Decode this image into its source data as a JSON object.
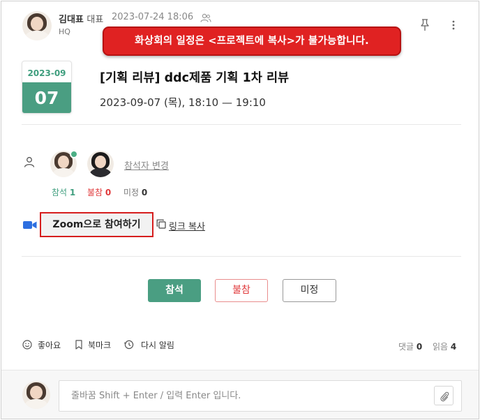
{
  "post": {
    "author_name": "김대표",
    "author_role": "대표",
    "date": "2023-07-24 18:06",
    "department": "HQ"
  },
  "toast": {
    "message": "화상회의 일정은 <프로젝트에 복사>가 불가능합니다."
  },
  "event": {
    "badge_month": "2023-09",
    "badge_day": "07",
    "title": "[기획 리뷰] ddc제품 기획 1차 리뷰",
    "time": "2023-09-07 (목), 18:10 — 19:10"
  },
  "attendees": {
    "change_label": "참석자 변경",
    "stats": [
      {
        "label": "참석",
        "count": "1"
      },
      {
        "label": "불참",
        "count": "0"
      },
      {
        "label": "미정",
        "count": "0"
      }
    ]
  },
  "zoom": {
    "join_label": "Zoom으로 참여하기",
    "copy_link_label": "링크 복사"
  },
  "rsvp": {
    "attend": "참석",
    "absent": "불참",
    "undecided": "미정"
  },
  "actions": {
    "like": "좋아요",
    "bookmark": "북마크",
    "remind": "다시 알림"
  },
  "counts": {
    "comments_label": "댓글",
    "comments": "0",
    "reads_label": "읽음",
    "reads": "4"
  },
  "comment": {
    "placeholder": "줄바꿈 Shift + Enter / 입력 Enter 입니다."
  },
  "colors": {
    "accent_green": "#4a9e82",
    "absent_red": "#e0393b",
    "toast_red": "#e02222",
    "highlight_border": "#d61d1d"
  },
  "icons": [
    "people-icon",
    "pin-icon",
    "more-icon",
    "person-icon",
    "video-icon",
    "copy-icon",
    "smile-icon",
    "bookmark-icon",
    "clock-icon",
    "paperclip-icon"
  ]
}
